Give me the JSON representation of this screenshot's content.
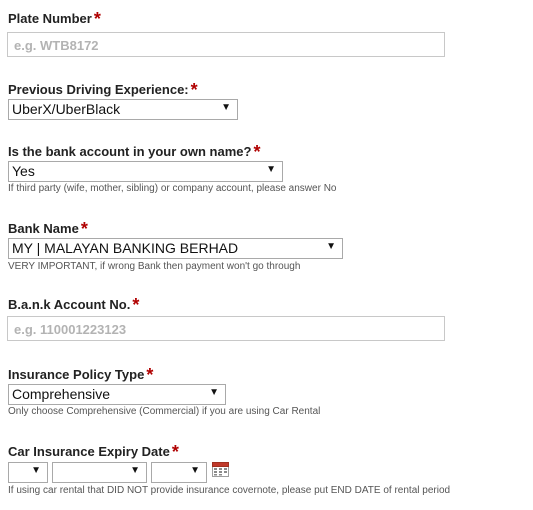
{
  "required_mark": "*",
  "plate": {
    "label": "Plate Number",
    "placeholder": "e.g. WTB8172"
  },
  "experience": {
    "label": "Previous Driving Experience:",
    "value": "UberX/UberBlack"
  },
  "bank_own": {
    "label": "Is the bank account in your own name?",
    "value": "Yes",
    "help": "If third party (wife, mother, sibling) or company account, please answer No"
  },
  "bank_name": {
    "label": "Bank Name",
    "value": "MY | MALAYAN BANKING BERHAD",
    "help": "VERY IMPORTANT, if wrong Bank then payment won't go through"
  },
  "account": {
    "label": "B.a.n.k Account No.",
    "placeholder": "e.g. 110001223123"
  },
  "insurance": {
    "label": "Insurance Policy Type",
    "value": "Comprehensive",
    "help": "Only choose Comprehensive (Commercial) if you are using Car Rental"
  },
  "expiry": {
    "label": "Car Insurance Expiry Date",
    "day": "",
    "month": "",
    "year": "",
    "help": "If using car rental that DID NOT provide insurance covernote, please put END DATE of rental period"
  },
  "dropdown_icon": "triangle-down",
  "calendar_icon": "calendar",
  "colors": {
    "required": "#b00000",
    "placeholder": "#b3b3b3",
    "calendar": "#c0392b"
  }
}
